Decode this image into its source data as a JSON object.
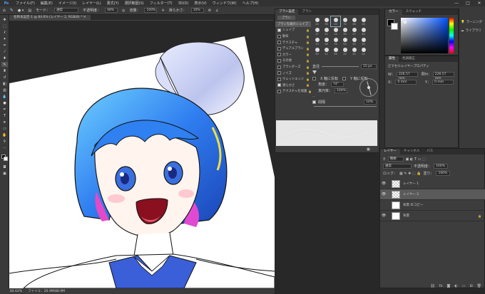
{
  "menubar": {
    "logo": "Ps",
    "items": [
      "ファイル(F)",
      "編集(E)",
      "イメージ(I)",
      "レイヤー(L)",
      "書式(Y)",
      "選択範囲(S)",
      "フィルター(T)",
      "3D(D)",
      "表示(V)",
      "ウィンドウ(W)",
      "ヘルプ(H)"
    ],
    "window_buttons": [
      "—",
      "□",
      "✕"
    ]
  },
  "options": {
    "mode_label": "モード：",
    "mode_value": "通常",
    "opacity_label": "不透明度：",
    "opacity_value": "48%",
    "flow_label": "流量：",
    "flow_value": "100%",
    "smooth_label": "滑らかさ：",
    "smooth_value": "10%"
  },
  "document": {
    "tab": "名称未設定-1 @ 84.6% (レイヤー 2, RGB/8) * ✕",
    "zoom": "84.62%",
    "file_info": "ファイル：26.9M/88.9M"
  },
  "brush_panel": {
    "tabs": [
      "ブラシ設定",
      "ブラシ"
    ],
    "top_item": "ブラシ",
    "preset_item": "ブラシ先端のシェイプ",
    "settings": [
      {
        "label": "シェイプ",
        "checked": true
      },
      {
        "label": "散布",
        "checked": false
      },
      {
        "label": "テクスチャ",
        "checked": false
      },
      {
        "label": "デュアルブラシ",
        "checked": false
      },
      {
        "label": "カラー",
        "checked": false
      },
      {
        "label": "その他",
        "checked": false
      },
      {
        "label": "ブラシポーズ",
        "checked": false
      },
      {
        "label": "ノイズ",
        "checked": false
      },
      {
        "label": "ウェットエッジ",
        "checked": false
      },
      {
        "label": "滑らかさ",
        "checked": true
      },
      {
        "label": "テクスチャを保護",
        "checked": false
      }
    ],
    "tip_sizes": [
      "24",
      "36",
      "20",
      "70",
      "58",
      "16",
      "17",
      "31",
      "14",
      "30",
      "27",
      "40",
      "70",
      "58",
      "70",
      "54",
      "25",
      "50",
      "50",
      "11",
      "55",
      "25",
      "25",
      "24"
    ],
    "size_label": "直径",
    "size_value": "15 px",
    "flipx_label": "X 軸に反転",
    "flipy_label": "Y 軸に反転",
    "angle_label": "角度：",
    "angle_value": "74°",
    "round_label": "真円率：",
    "round_value": "100%",
    "spacing_label": "間隔",
    "spacing_value": "10%"
  },
  "color_panel": {
    "tabs": [
      "カラー",
      "スウォッチ"
    ],
    "base_color": "#0052ff"
  },
  "adjust_panel": {
    "tabs": [
      "属性",
      "色調補正"
    ],
    "subtitle": "ピクセルレイヤープロパティ",
    "w_label": "W：",
    "w_value": "226.57 mm",
    "h_label": "H：",
    "h_value": "226.57 mm",
    "x_label": "X：",
    "x_value": "0 mm",
    "y_label": "Y：",
    "y_value": "0 mm"
  },
  "library": {
    "items": [
      "ラーニング",
      "ライブラリ"
    ]
  },
  "layers_panel": {
    "tabs": [
      "レイヤー",
      "チャンネル",
      "パス"
    ],
    "kind_label": "種類",
    "blend_value": "通常",
    "opacity_label": "不透明度：",
    "opacity_value": "100%",
    "lock_label": "ロック：",
    "fill_label": "塗り：",
    "fill_value": "100%",
    "layers": [
      {
        "name": "レイヤー 1",
        "visible": true,
        "selected": false
      },
      {
        "name": "レイヤー 2",
        "visible": true,
        "selected": true
      },
      {
        "name": "背景 のコピー",
        "visible": false,
        "selected": false
      },
      {
        "name": "背景",
        "visible": true,
        "selected": false
      }
    ]
  }
}
